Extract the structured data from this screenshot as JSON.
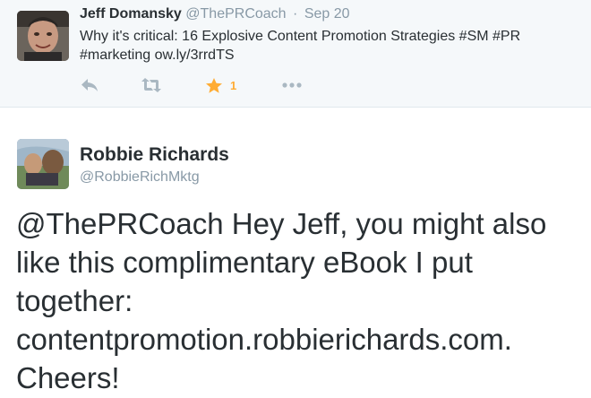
{
  "top_tweet": {
    "name": "Jeff Domansky",
    "handle": "@ThePRCoach",
    "separator": "·",
    "date": "Sep 20",
    "text_line1": "Why it's critical: 16 Explosive Content Promotion Strategies #SM #PR",
    "text_line2": "#marketing ow.ly/3rrdTS",
    "actions": {
      "reply_icon": "reply-icon",
      "retweet_icon": "retweet-icon",
      "favorite_icon": "star-icon",
      "favorite_count": "1",
      "more_icon": "more-dots-icon"
    }
  },
  "main_tweet": {
    "name": "Robbie Richards",
    "handle": "@RobbieRichMktg",
    "text_lines": [
      "@ThePRCoach Hey Jeff, you might also",
      "like this complimentary eBook I put",
      "together:",
      "contentpromotion.robbierichards.com.",
      "Cheers!"
    ]
  },
  "colors": {
    "top_bg": "#f5f8fa",
    "text": "#292f33",
    "muted": "#8899a6",
    "favorite": "#ffac33",
    "action_icon": "#aab8c2"
  }
}
